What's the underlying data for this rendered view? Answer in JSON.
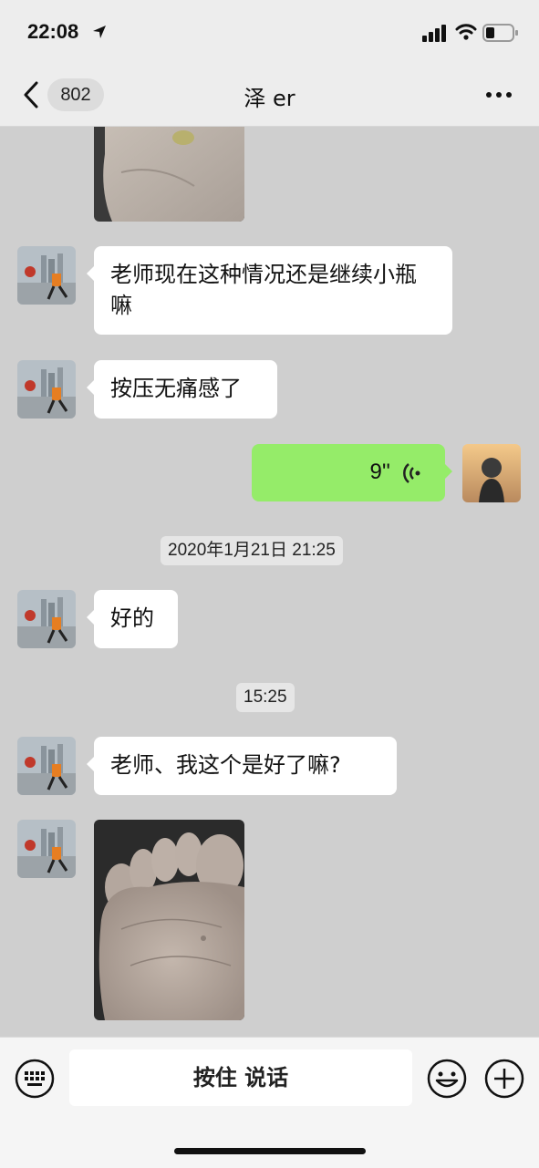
{
  "status_bar": {
    "time": "22:08"
  },
  "header": {
    "back_count": "802",
    "title": "泽 er"
  },
  "messages": [
    {
      "type": "text",
      "from": "other",
      "text": "老师现在这种情况还是继续小瓶嘛"
    },
    {
      "type": "text",
      "from": "other",
      "text": "按压无痛感了"
    },
    {
      "type": "voice",
      "from": "me",
      "duration": "9''"
    },
    {
      "type": "timestamp",
      "text": "2020年1月21日 21:25"
    },
    {
      "type": "text",
      "from": "other",
      "text": "好的"
    },
    {
      "type": "timestamp",
      "text": "15:25"
    },
    {
      "type": "text",
      "from": "other",
      "text": "老师、我这个是好了嘛?"
    },
    {
      "type": "image",
      "from": "other",
      "subject": "foot sole photo"
    }
  ],
  "input_bar": {
    "talk_label": "按住 说话"
  },
  "icons": {
    "keyboard": "keyboard-icon",
    "emoji": "emoji-icon",
    "plus": "plus-icon"
  }
}
